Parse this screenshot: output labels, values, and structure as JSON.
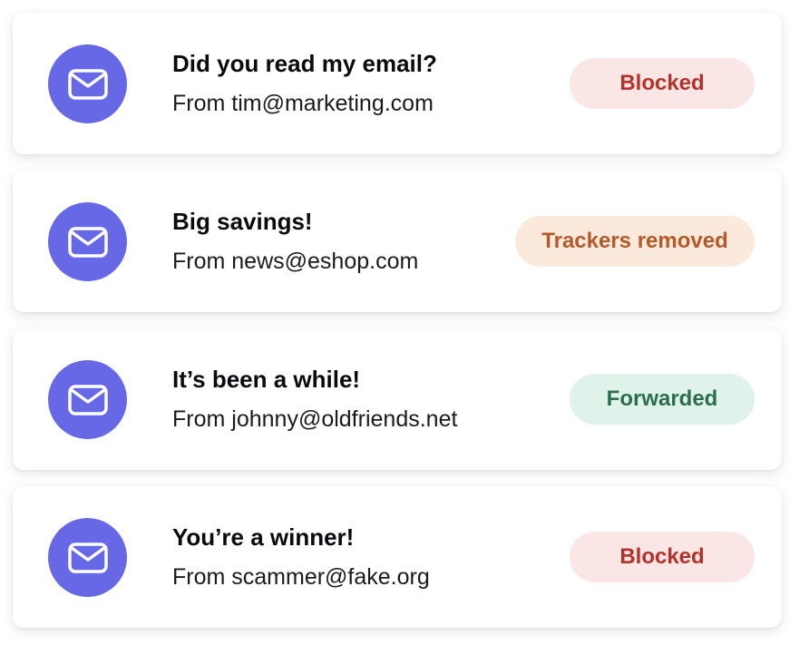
{
  "emails": [
    {
      "subject": "Did you read my email?",
      "sender": "From tim@marketing.com",
      "status": "Blocked",
      "status_type": "blocked"
    },
    {
      "subject": "Big savings!",
      "sender": "From news@eshop.com",
      "status": "Trackers removed",
      "status_type": "trackers"
    },
    {
      "subject": "It’s been a while!",
      "sender": "From johnny@oldfriends.net",
      "status": "Forwarded",
      "status_type": "forwarded"
    },
    {
      "subject": "You’re a winner!",
      "sender": "From scammer@fake.org",
      "status": "Blocked",
      "status_type": "blocked"
    }
  ],
  "icon": "envelope-icon",
  "colors": {
    "avatar": "#6668e6",
    "blocked_bg": "#f9e6e5",
    "blocked_text": "#b8302a",
    "trackers_bg": "#fbeadb",
    "trackers_text": "#b4592a",
    "forwarded_bg": "#e0f3ea",
    "forwarded_text": "#2c6d4d"
  }
}
